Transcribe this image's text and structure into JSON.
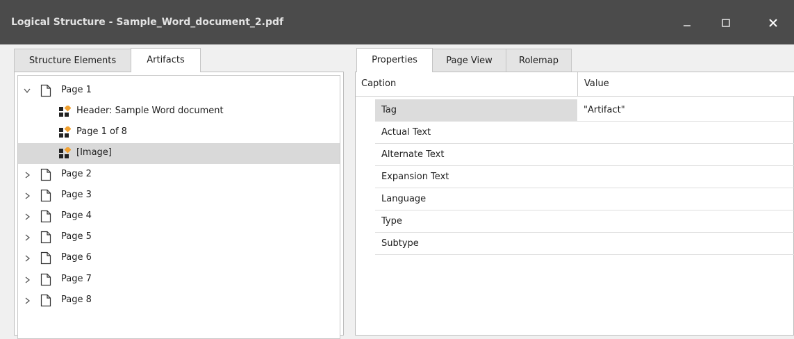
{
  "window": {
    "title": "Logical Structure - Sample_Word_document_2.pdf",
    "bg_color": "#4b4b4b"
  },
  "left_tabs": [
    {
      "label": "Structure Elements",
      "active": false
    },
    {
      "label": "Artifacts",
      "active": true
    }
  ],
  "tree": {
    "page1": "Page 1",
    "children": [
      {
        "label": "Header: Sample Word document"
      },
      {
        "label": "Page 1 of 8"
      },
      {
        "label": "[Image]",
        "selected": true
      }
    ],
    "pages": [
      "Page 2",
      "Page 3",
      "Page 4",
      "Page 5",
      "Page 6",
      "Page 7",
      "Page 8"
    ],
    "artifact_icon_accent": "#f0a030"
  },
  "right_tabs": [
    {
      "label": "Properties",
      "active": true
    },
    {
      "label": "Page View",
      "active": false
    },
    {
      "label": "Rolemap",
      "active": false
    }
  ],
  "grid": {
    "caption_header": "Caption",
    "value_header": "Value",
    "rows": [
      {
        "name": "Tag",
        "value": "\"Artifact\""
      },
      {
        "name": "Actual Text",
        "value": ""
      },
      {
        "name": "Alternate Text",
        "value": ""
      },
      {
        "name": "Expansion Text",
        "value": ""
      },
      {
        "name": "Language",
        "value": ""
      },
      {
        "name": "Type",
        "value": ""
      },
      {
        "name": "Subtype",
        "value": ""
      }
    ]
  }
}
